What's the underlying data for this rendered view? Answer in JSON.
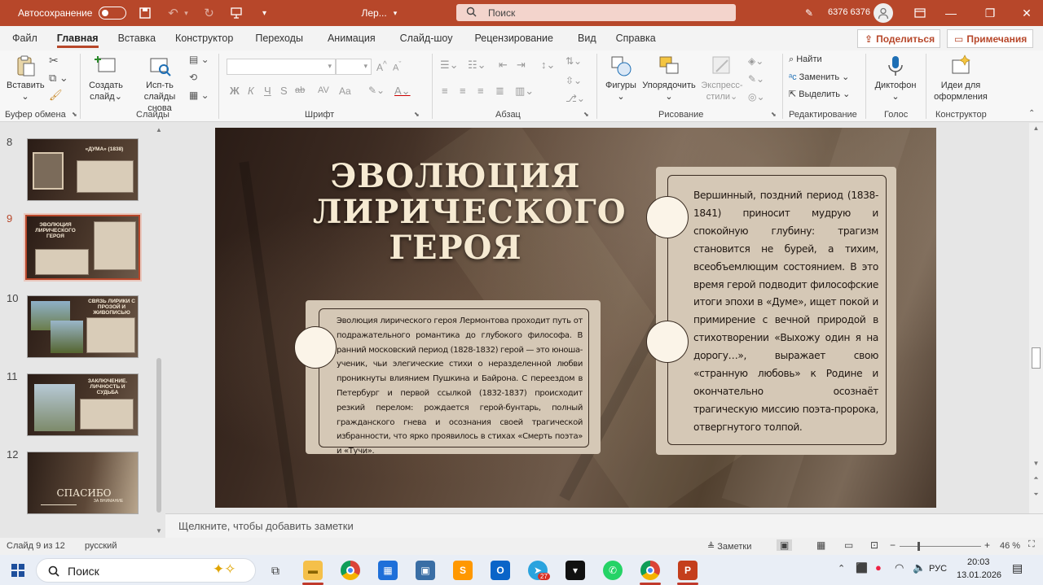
{
  "titlebar": {
    "autosave_label": "Автосохранение",
    "doc_name": "Лер...",
    "search_placeholder": "Поиск",
    "user": "6376 6376"
  },
  "menu": {
    "tabs": [
      "Файл",
      "Главная",
      "Вставка",
      "Конструктор",
      "Переходы",
      "Анимация",
      "Слайд-шоу",
      "Рецензирование",
      "Вид",
      "Справка"
    ],
    "share": "Поделиться",
    "comments": "Примечания"
  },
  "ribbon": {
    "paste": "Вставить",
    "new_slide": "Создать слайд",
    "reuse": "Исп-ть слайды снова",
    "groups": {
      "clipboard": "Буфер обмена",
      "slides": "Слайды",
      "font": "Шрифт",
      "paragraph": "Абзац",
      "drawing": "Рисование",
      "editing": "Редактирование",
      "voice": "Голос",
      "designer": "Конструктор"
    },
    "shapes": "Фигуры",
    "arrange": "Упорядочить",
    "quick_styles": "Экспресс-стили",
    "find": "Найти",
    "replace": "Заменить",
    "select": "Выделить",
    "dictate": "Диктофон",
    "design_ideas": "Идеи для оформления",
    "font_btns": [
      "Ж",
      "К",
      "Ч",
      "S",
      "ab",
      "AV",
      "Aa"
    ]
  },
  "thumbnails": [
    {
      "num": "8",
      "title": "«ДУМА» (1838)"
    },
    {
      "num": "9",
      "title": "ЭВОЛЮЦИЯ ЛИРИЧЕСКОГО ГЕРОЯ"
    },
    {
      "num": "10",
      "title": "СВЯЗЬ ЛИРИКИ С ПРОЗОЙ И ЖИВОПИСЬЮ"
    },
    {
      "num": "11",
      "title": "ЗАКЛЮЧЕНИЕ. ЛИЧНОСТЬ И СУДЬБА"
    },
    {
      "num": "12",
      "title": "СПАСИБО",
      "subtitle": "ЗА ВНИМАНИЕ"
    }
  ],
  "slide": {
    "title_line1": "ЭВОЛЮЦИЯ",
    "title_line2": "ЛИРИЧЕСКОГО",
    "title_line3": "ГЕРОЯ",
    "left_text": "Эволюция лирического героя Лермонтова проходит путь от подражательного романтика до глубокого философа. В ранний московский период (1828-1832) герой — это юноша-ученик, чьи элегические стихи о неразделенной любви проникнуты влиянием Пушкина и Байрона. С переездом в Петербург и первой ссылкой (1832-1837) происходит резкий перелом: рождается герой-бунтарь, полный гражданского гнева и осознания своей трагической избранности, что ярко проявилось в стихах «Смерть поэта» и «Тучи».",
    "right_text": "Вершинный, поздний период (1838-1841) приносит мудрую и спокойную глубину: трагизм становится не бурей, а тихим, всеобъемлющим состоянием. В это время герой подводит философские итоги эпохи в «Думе», ищет покой и примирение с вечной природой в стихотворении «Выхожу один я на дорогу…», выражает свою «странную любовь» к Родине и окончательно осознаёт трагическую миссию поэта-пророка, отвергнутого толпой."
  },
  "notes_placeholder": "Щелкните, чтобы добавить заметки",
  "status": {
    "slide_of": "Слайд 9 из 12",
    "language": "русский",
    "notes_btn": "Заметки",
    "zoom": "46 %"
  },
  "taskbar": {
    "search": "Поиск",
    "lang": "РУС",
    "time": "20:03",
    "date": "13.01.2026",
    "telegram_badge": "27"
  },
  "colors": {
    "accent": "#b7472a",
    "card": "#d5c8b6",
    "title": "#f6ead2"
  }
}
